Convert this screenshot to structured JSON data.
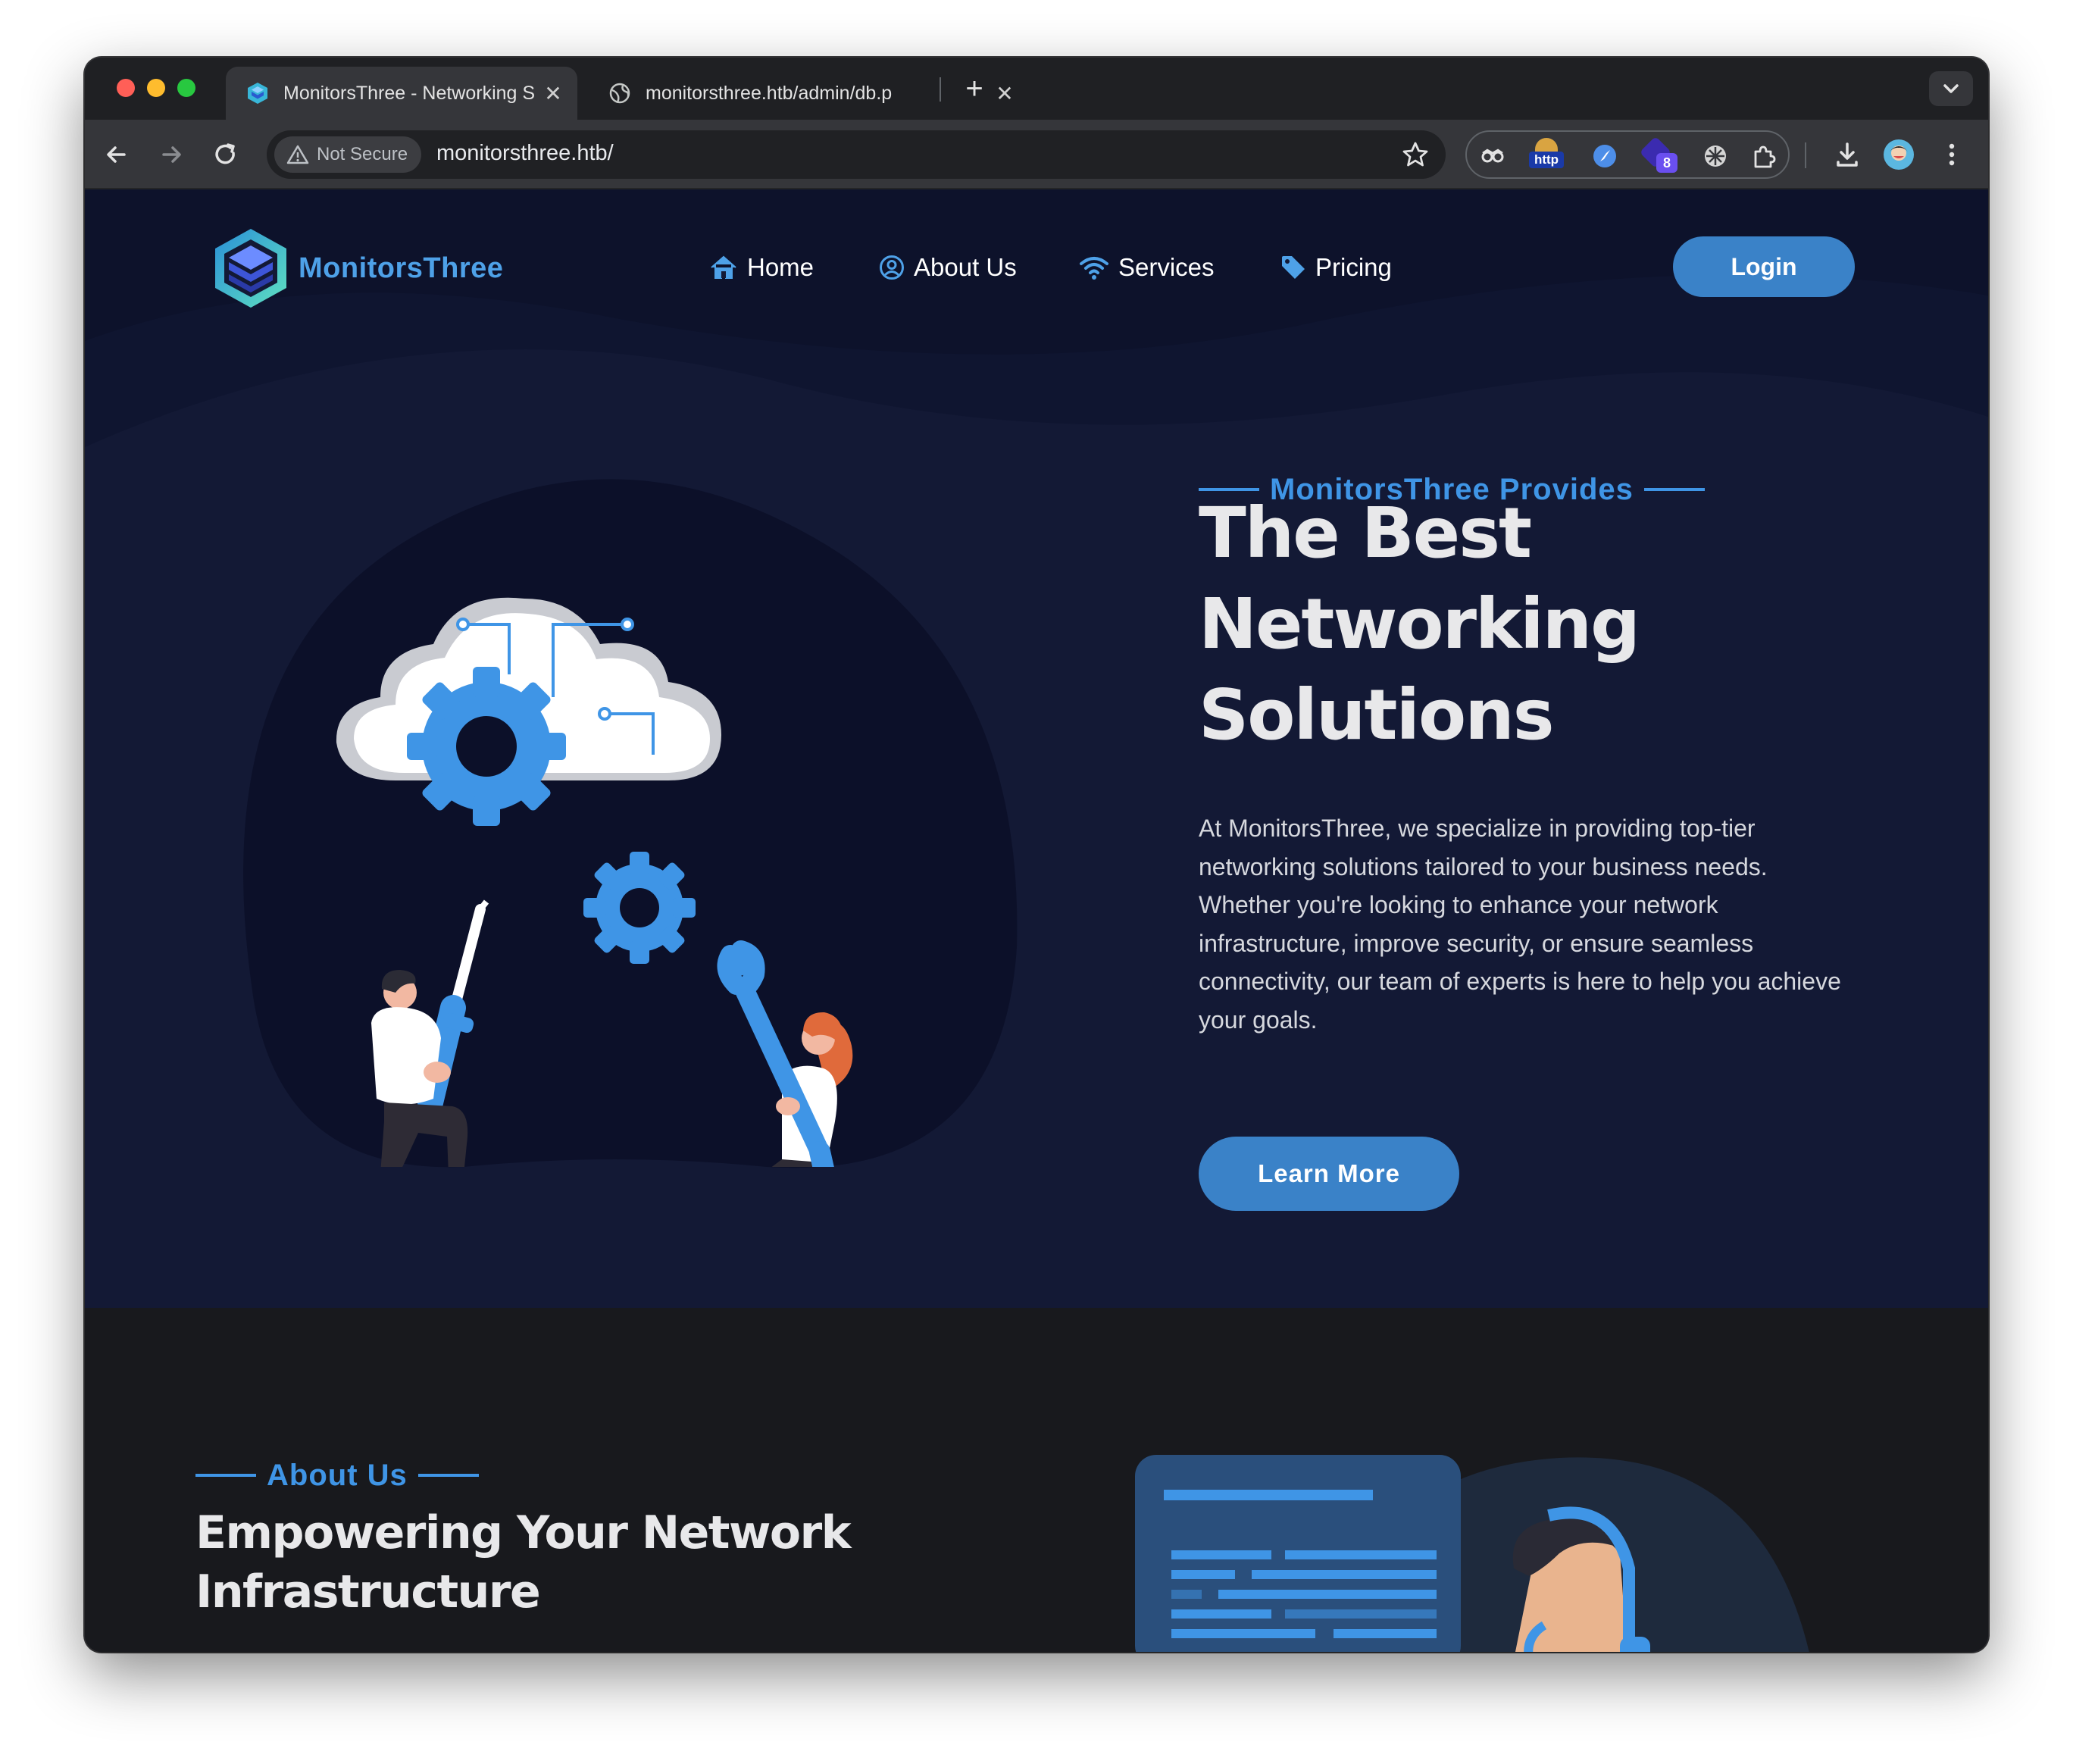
{
  "browser": {
    "tabs": [
      {
        "title": "MonitorsThree - Networking S",
        "active": true
      },
      {
        "title": "monitorsthree.htb/admin/db.p",
        "active": false
      }
    ],
    "security_label": "Not Secure",
    "url": "monitorsthree.htb/",
    "extension_badges": {
      "http": "http",
      "count": "8"
    }
  },
  "site": {
    "brand": "MonitorsThree",
    "nav": [
      {
        "label": "Home",
        "icon": "home-icon"
      },
      {
        "label": "About Us",
        "icon": "user-circle-icon"
      },
      {
        "label": "Services",
        "icon": "wifi-icon"
      },
      {
        "label": "Pricing",
        "icon": "tag-icon"
      }
    ],
    "login_label": "Login",
    "hero": {
      "eyebrow": "MonitorsThree Provides",
      "title_lines": [
        "The Best",
        "Networking",
        "Solutions"
      ],
      "description": "At MonitorsThree, we specialize in providing top-tier networking solutions tailored to your business needs. Whether you're looking to enhance your network infrastructure, improve security, or ensure seamless connectivity, our team of experts is here to help you achieve your goals.",
      "cta_label": "Learn More"
    },
    "about": {
      "eyebrow": "About Us",
      "title_lines": [
        "Empowering Your Network",
        "Infrastructure"
      ]
    }
  },
  "colors": {
    "accent": "#3f95e6",
    "button": "#3a82c8",
    "hero_bg": "#131935",
    "about_bg": "#18191d"
  }
}
